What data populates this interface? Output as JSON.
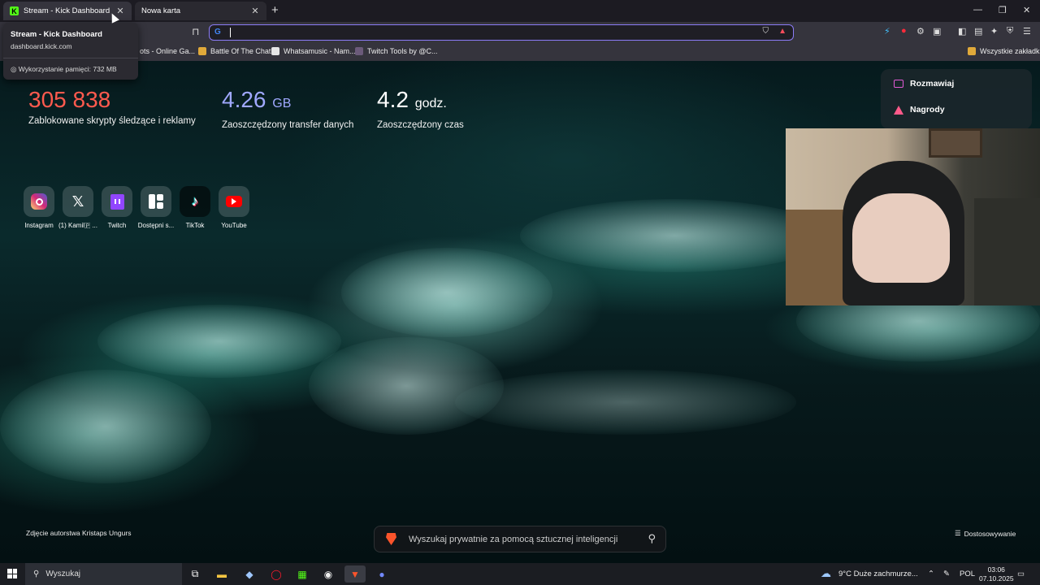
{
  "tabs": [
    {
      "title": "Stream - Kick Dashboard",
      "favicon": "kick-icon",
      "active": true
    },
    {
      "title": "Nowa karta",
      "active": false
    }
  ],
  "tab_card": {
    "title": "Stream - Kick Dashboard",
    "url": "dashboard.kick.com",
    "memory": "Wykorzystanie pamięci: 732 MB"
  },
  "bookmarks": [
    {
      "label": "ots - Online Ga...",
      "icon": "game-icon"
    },
    {
      "label": "Battle Of The Chat",
      "icon": "folder-icon"
    },
    {
      "label": "Whatsamusic - Nam...",
      "icon": "whatsamusic-icon"
    },
    {
      "label": "Twitch Tools by @C...",
      "icon": "twitch-tools-icon"
    },
    {
      "label": "Wszystkie zakładki",
      "icon": "folder-icon"
    }
  ],
  "stats": [
    {
      "value": "305 838",
      "unit": "",
      "label": "Zablokowane skrypty śledzące i reklamy",
      "color": "#ff5a4e"
    },
    {
      "value": "4.26",
      "unit": "GB",
      "label": "Zaoszczędzony transfer danych",
      "color": "#a0a8ff"
    },
    {
      "value": "4.2",
      "unit": "godz.",
      "label": "Zaoszczędzony czas",
      "color": "#ffffff"
    }
  ],
  "shortcuts": [
    {
      "label": "Instagram",
      "icon": "instagram-icon"
    },
    {
      "label": "(1) Kamil🇵 ...",
      "icon": "x-icon"
    },
    {
      "label": "Twitch",
      "icon": "twitch-icon"
    },
    {
      "label": "Dostępni s...",
      "icon": "kick-dashboard-icon"
    },
    {
      "label": "TikTok",
      "icon": "tiktok-icon"
    },
    {
      "label": "YouTube",
      "icon": "youtube-icon"
    }
  ],
  "side_menu": {
    "chat": "Rozmawiaj",
    "rewards": "Nagrody"
  },
  "photo_credit": "Zdjęcie autorstwa Kristaps Ungurs",
  "search": {
    "placeholder": "Wyszukaj prywatnie za pomocą sztucznej inteligencji"
  },
  "customize": "Dostosowywanie",
  "taskbar": {
    "search": "Wyszukaj",
    "weather": "9°C  Duże zachmurze...",
    "lang": "POL",
    "time": "03:06",
    "date": "07.10.2025"
  },
  "colors": {
    "accent": "#8b7cf6",
    "kick_green": "#53fc18",
    "brave_orange": "#fb542b"
  }
}
